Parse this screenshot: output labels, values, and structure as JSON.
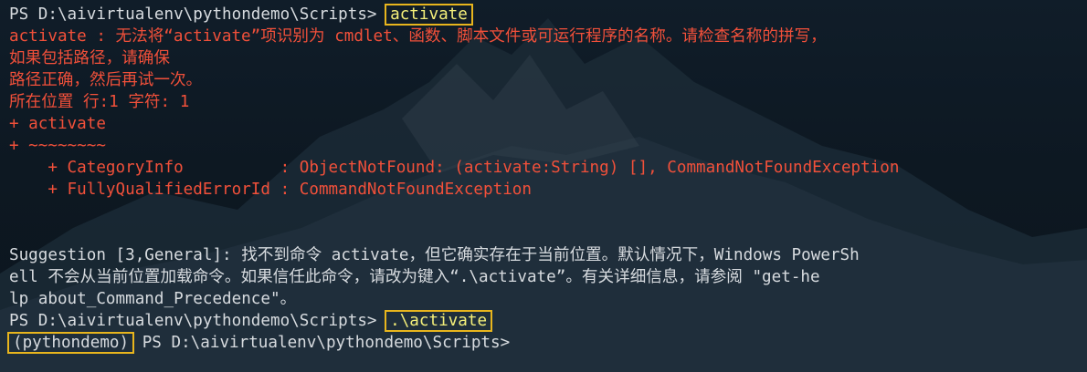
{
  "terminal": {
    "prompt1": "PS D:\\aivirtualenv\\pythondemo\\Scripts>",
    "cmd1": "activate",
    "error_lines": [
      "activate : 无法将“activate”项识别为 cmdlet、函数、脚本文件或可运行程序的名称。请检查名称的拼写，",
      "如果包括路径，请确保",
      "路径正确，然后再试一次。",
      "所在位置 行:1 字符: 1",
      "+ activate",
      "+ ~~~~~~~~",
      "    + CategoryInfo          : ObjectNotFound: (activate:String) [], CommandNotFoundException",
      "    + FullyQualifiedErrorId : CommandNotFoundException"
    ],
    "suggestion_lines": [
      "Suggestion [3,General]: 找不到命令 activate，但它确实存在于当前位置。默认情况下，Windows PowerSh",
      "ell 不会从当前位置加载命令。如果信任此命令，请改为键入“.\\activate”。有关详细信息，请参阅 \"get-he",
      "lp about_Command_Precedence\"。"
    ],
    "prompt2": "PS D:\\aivirtualenv\\pythondemo\\Scripts>",
    "cmd2": ".\\activate",
    "venv": "(pythondemo)",
    "prompt3": " PS D:\\aivirtualenv\\pythondemo\\Scripts>"
  },
  "colors": {
    "error": "#f1503a",
    "command": "#f4ef7a",
    "text": "#d7dbdf",
    "highlight_box": "#e8b51d",
    "background": "#0f1a23"
  }
}
